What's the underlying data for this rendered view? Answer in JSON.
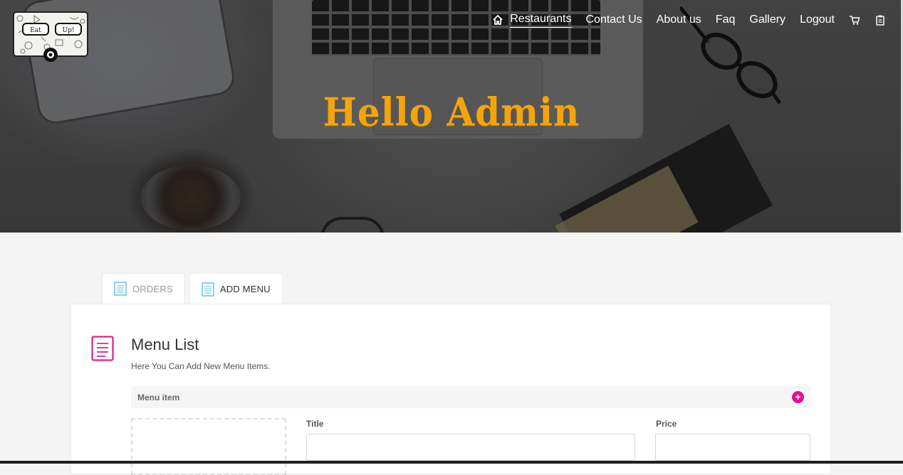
{
  "logo": {
    "left_sign": "Eat",
    "right_sign": "Up!"
  },
  "nav": {
    "home_icon": "home-icon",
    "items": [
      "Restaurants",
      "Contact Us",
      "About us",
      "Faq",
      "Gallery",
      "Logout"
    ],
    "cart_icon": "cart-icon",
    "clipboard_icon": "clipboard-icon"
  },
  "hero": {
    "title": "Hello Admin",
    "title_color": "#f5a40c"
  },
  "tabs": [
    {
      "label": "ORDERS",
      "icon": "document-icon",
      "active": false
    },
    {
      "label": "ADD MENU",
      "icon": "document-icon",
      "active": true
    }
  ],
  "panel": {
    "title": "Menu List",
    "subtitle": "Here You Can Add New Menu Items.",
    "menu_bar_label": "Menu item",
    "add_icon": "plus-circle-icon",
    "accent_color": "#e0118a",
    "fields": {
      "title_label": "Title",
      "title_value": "",
      "price_label": "Price",
      "price_value": ""
    }
  }
}
